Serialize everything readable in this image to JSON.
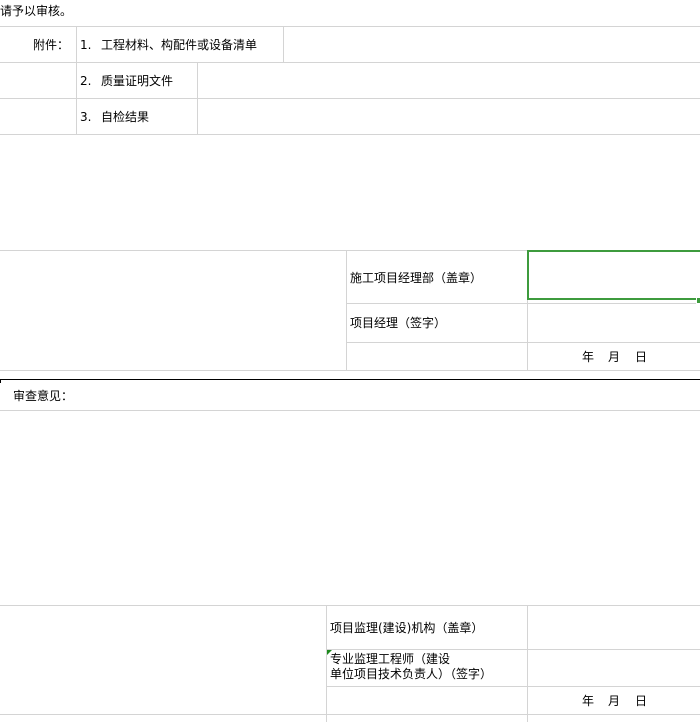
{
  "sheet": {
    "intro_text": "请予以审核。",
    "attachments_label": "附件：",
    "attachments": [
      {
        "number": "1.",
        "text": "工程材料、构配件或设备清单"
      },
      {
        "number": "2.",
        "text": "质量证明文件"
      },
      {
        "number": "3.",
        "text": "自检结果"
      }
    ],
    "contractor": {
      "dept_label": "施工项目经理部（盖章）",
      "manager_label": "项目经理（签字）",
      "date": {
        "year": "年",
        "month": "月",
        "day": "日"
      }
    },
    "review_label": "审查意见：",
    "supervisor": {
      "org_label": "项目监理(建设)机构（盖章）",
      "engineer_label_line1": "专业监理工程师（建设",
      "engineer_label_line2": "单位项目技术负责人）（签字）",
      "date": {
        "year": "年",
        "month": "月",
        "day": "日"
      }
    },
    "colors": {
      "gridline": "#d4d4d4",
      "selection": "#3d9b3d",
      "comment_marker": "#1e8a1e"
    }
  }
}
